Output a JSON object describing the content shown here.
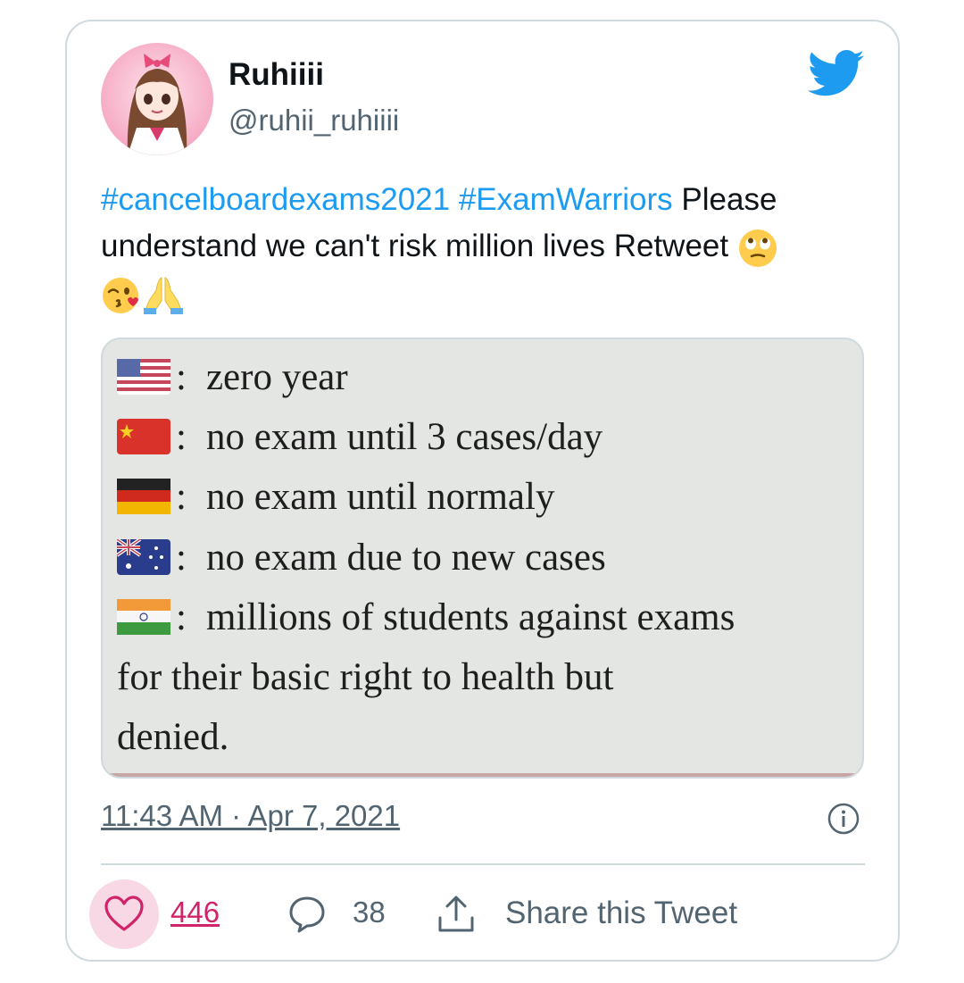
{
  "author": {
    "display_name": "Ruhiiii",
    "handle": "@ruhii_ruhiiii"
  },
  "tweet": {
    "hashtag1": "#cancelboardexams2021",
    "hashtag2": "#ExamWarriors",
    "text_part1": " Please understand we can't risk million lives Retweet ",
    "emojis": [
      "eye-roll-emoji",
      "kiss-wink-emoji",
      "praying-hands-emoji"
    ]
  },
  "media": {
    "lines": [
      {
        "flag": "usa-flag",
        "text": "zero year"
      },
      {
        "flag": "china-flag",
        "text": "no exam until 3 cases/day"
      },
      {
        "flag": "germany-flag",
        "text": "no exam until normaly"
      },
      {
        "flag": "australia-flag",
        "text": "no exam due to new cases"
      },
      {
        "flag": "india-flag",
        "text": "millions of students against exams"
      }
    ],
    "continuation1": "for their basic right to health but",
    "continuation2": "denied."
  },
  "meta": {
    "timestamp": "11:43 AM · Apr 7, 2021"
  },
  "actions": {
    "like_count": "446",
    "reply_count": "38",
    "share_label": "Share this Tweet"
  },
  "colors": {
    "accent": "#1d9bf0",
    "like": "#d0246a",
    "muted": "#536471",
    "border": "#cfd9de"
  }
}
